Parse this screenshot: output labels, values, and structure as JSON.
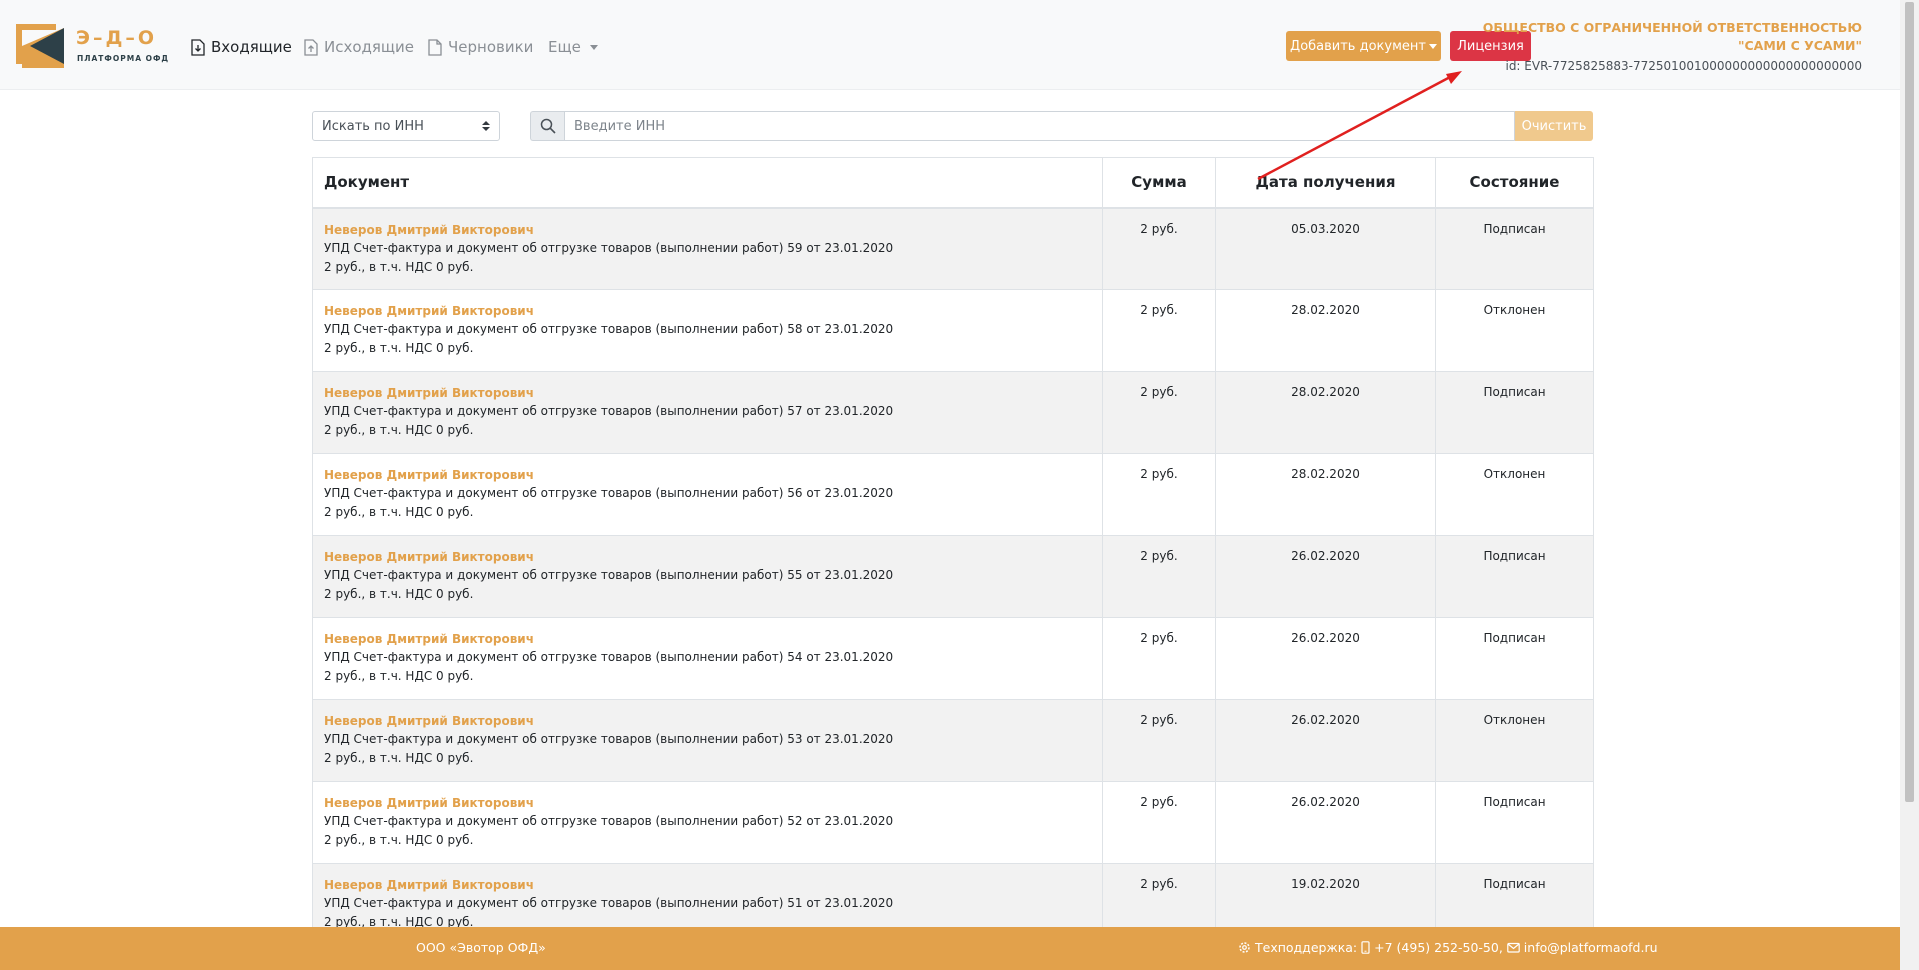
{
  "brand": {
    "title": "Э–Д–О",
    "subtitle": "ПЛАТФОРМА ОФД",
    "colors": {
      "orange": "#e2a14b",
      "dark": "#2d4048",
      "danger": "#dc3545"
    }
  },
  "nav": {
    "incoming": "Входящие",
    "outgoing": "Исходящие",
    "drafts": "Черновики",
    "more": "Еще"
  },
  "actions": {
    "add_document": "Добавить документ",
    "license": "Лицензия"
  },
  "org": {
    "name_line1": "ОБЩЕСТВО С ОГРАНИЧЕННОЙ ОТВЕТСТВЕННОСТЬЮ",
    "name_line2": "\"САМИ С УСАМИ\"",
    "id": "id: EVR-7725825883-772501001000000000000000000000"
  },
  "search": {
    "mode": "Искать по ИНН",
    "placeholder": "Введите ИНН",
    "clear": "Очистить"
  },
  "table": {
    "headers": {
      "document": "Документ",
      "sum": "Сумма",
      "date": "Дата получения",
      "status": "Состояние"
    },
    "rows": [
      {
        "author": "Неверов Дмитрий Викторович",
        "title": "УПД Счет-фактура и документ об отгрузке товаров (выполнении работ) 59 от 23.01.2020",
        "amount_line": "2 руб., в т.ч. НДС 0 руб.",
        "sum": "2 руб.",
        "date": "05.03.2020",
        "status": "Подписан"
      },
      {
        "author": "Неверов Дмитрий Викторович",
        "title": "УПД Счет-фактура и документ об отгрузке товаров (выполнении работ) 58 от 23.01.2020",
        "amount_line": "2 руб., в т.ч. НДС 0 руб.",
        "sum": "2 руб.",
        "date": "28.02.2020",
        "status": "Отклонен"
      },
      {
        "author": "Неверов Дмитрий Викторович",
        "title": "УПД Счет-фактура и документ об отгрузке товаров (выполнении работ) 57 от 23.01.2020",
        "amount_line": "2 руб., в т.ч. НДС 0 руб.",
        "sum": "2 руб.",
        "date": "28.02.2020",
        "status": "Подписан"
      },
      {
        "author": "Неверов Дмитрий Викторович",
        "title": "УПД Счет-фактура и документ об отгрузке товаров (выполнении работ) 56 от 23.01.2020",
        "amount_line": "2 руб., в т.ч. НДС 0 руб.",
        "sum": "2 руб.",
        "date": "28.02.2020",
        "status": "Отклонен"
      },
      {
        "author": "Неверов Дмитрий Викторович",
        "title": "УПД Счет-фактура и документ об отгрузке товаров (выполнении работ) 55 от 23.01.2020",
        "amount_line": "2 руб., в т.ч. НДС 0 руб.",
        "sum": "2 руб.",
        "date": "26.02.2020",
        "status": "Подписан"
      },
      {
        "author": "Неверов Дмитрий Викторович",
        "title": "УПД Счет-фактура и документ об отгрузке товаров (выполнении работ) 54 от 23.01.2020",
        "amount_line": "2 руб., в т.ч. НДС 0 руб.",
        "sum": "2 руб.",
        "date": "26.02.2020",
        "status": "Подписан"
      },
      {
        "author": "Неверов Дмитрий Викторович",
        "title": "УПД Счет-фактура и документ об отгрузке товаров (выполнении работ) 53 от 23.01.2020",
        "amount_line": "2 руб., в т.ч. НДС 0 руб.",
        "sum": "2 руб.",
        "date": "26.02.2020",
        "status": "Отклонен"
      },
      {
        "author": "Неверов Дмитрий Викторович",
        "title": "УПД Счет-фактура и документ об отгрузке товаров (выполнении работ) 52 от 23.01.2020",
        "amount_line": "2 руб., в т.ч. НДС 0 руб.",
        "sum": "2 руб.",
        "date": "26.02.2020",
        "status": "Подписан"
      },
      {
        "author": "Неверов Дмитрий Викторович",
        "title": "УПД Счет-фактура и документ об отгрузке товаров (выполнении работ) 51 от 23.01.2020",
        "amount_line": "2 руб., в т.ч. НДС 0 руб.",
        "sum": "2 руб.",
        "date": "19.02.2020",
        "status": "Подписан"
      }
    ]
  },
  "footer": {
    "company": "ООО «Эвотор ОФД»",
    "support_label": "Техподдержка:",
    "phone": "+7 (495) 252-50-50,",
    "email": "info@platformaofd.ru"
  }
}
